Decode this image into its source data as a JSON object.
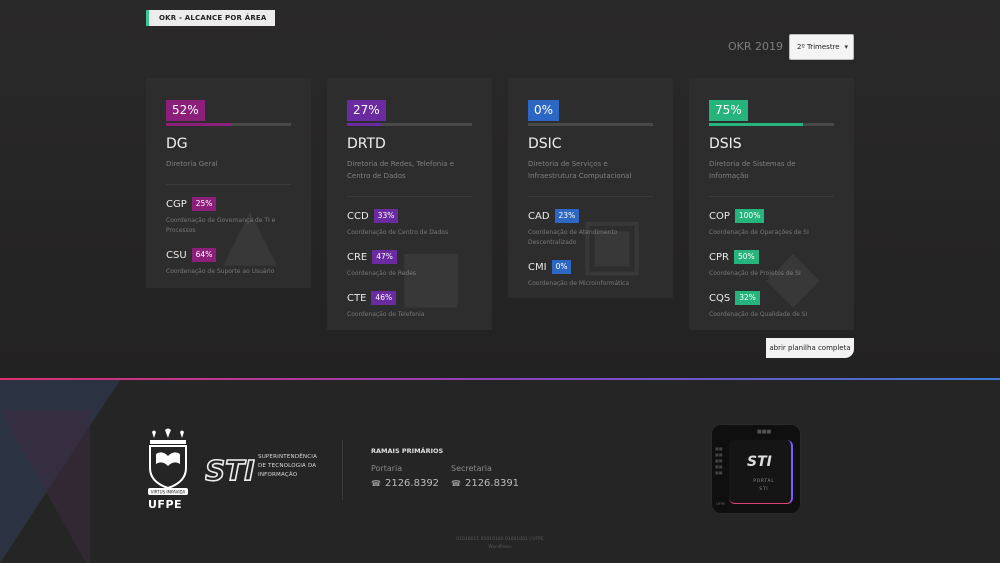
{
  "section_tag": "OKR - ALCANCE POR ÁREA",
  "okr_year": "OKR 2019",
  "quarter_select": {
    "value": "2º Trimestre",
    "chevron": "chevron-down-icon"
  },
  "colors": {
    "DG": "#8b1f7a",
    "DRTD": "#6a2aa0",
    "DSIC": "#2d67c4",
    "DSIS": "#26b37c"
  },
  "cards": [
    {
      "pct": "52%",
      "progress": 0.52,
      "code": "DG",
      "name": "Diretoria Geral",
      "subs": [
        {
          "code": "CGP",
          "pct": "25%",
          "desc": "Coordenação de Governança de TI e Processos"
        },
        {
          "code": "CSU",
          "pct": "64%",
          "desc": "Coordenação de Suporte ao Usuário"
        }
      ]
    },
    {
      "pct": "27%",
      "progress": 0.27,
      "code": "DRTD",
      "name": "Diretoria de Redes, Telefonia e Centro de Dados",
      "subs": [
        {
          "code": "CCD",
          "pct": "33%",
          "desc": "Coordenação de Centro de Dados"
        },
        {
          "code": "CRE",
          "pct": "47%",
          "desc": "Coordenação de Redes"
        },
        {
          "code": "CTE",
          "pct": "46%",
          "desc": "Coordenação de Telefonia"
        }
      ]
    },
    {
      "pct": "0%",
      "progress": 0.0,
      "code": "DSIC",
      "name": "Diretoria de Serviços e Infraestrutura Computacional",
      "subs": [
        {
          "code": "CAD",
          "pct": "23%",
          "desc": "Coordenação de Atendimento Descentralizado"
        },
        {
          "code": "CMI",
          "pct": "0%",
          "desc": "Coordenação de Microinformática"
        }
      ]
    },
    {
      "pct": "75%",
      "progress": 0.75,
      "code": "DSIS",
      "name": "Diretoria de Sistemas de Informação",
      "subs": [
        {
          "code": "COP",
          "pct": "100%",
          "desc": "Coordenação de Operações de SI"
        },
        {
          "code": "CPR",
          "pct": "50%",
          "desc": "Coordenação de Projetos de SI"
        },
        {
          "code": "CQS",
          "pct": "32%",
          "desc": "Coordenação de Qualidade de SI"
        }
      ]
    }
  ],
  "open_sheet_label": "abrir planilha completa",
  "footer": {
    "ufpe_label": "UFPE",
    "ufpe_motto": "VIRTUS IMPAVIDA",
    "sti_logo_text": "STI",
    "sti_sub": [
      "SUPERINTENDÊNCIA",
      "DE TECNOLOGIA DA",
      "INFORMAÇÃO"
    ],
    "ramais_title": "RAMAIS PRIMÁRIOS",
    "phones": [
      {
        "label": "Portaria",
        "number": "2126.8392"
      },
      {
        "label": "Secretaria",
        "number": "2126.8391"
      }
    ],
    "portal_label_1": "PORTAL",
    "portal_label_2": "STI",
    "credit_line_1": "01010011 01010100 01001001 | UFPE",
    "credit_line_2": "WordPress"
  }
}
